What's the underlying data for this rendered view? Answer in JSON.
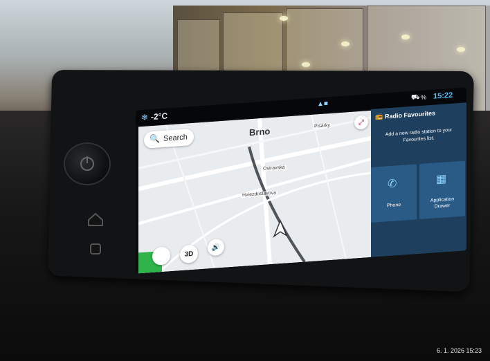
{
  "status": {
    "temperature": "-2°C",
    "time": "15:22",
    "battery": "%"
  },
  "map": {
    "city": "Brno",
    "search_label": "Search",
    "street_1": "Ostravská",
    "street_2": "Hviezdoslavova",
    "street_3": "Pisárky",
    "mode_button": "3D"
  },
  "panel": {
    "title": "Radio Favourites",
    "message": "Add a new radio station to your Favourites list.",
    "tiles": [
      {
        "label": "Phone",
        "icon": "phone-icon"
      },
      {
        "label": "Application Drawer",
        "icon": "app-drawer-icon"
      }
    ]
  },
  "photo": {
    "timestamp": "6. 1. 2026 15:23"
  },
  "colors": {
    "panel_bg": "#1e3f5e",
    "tile_bg": "#2a5a86",
    "status_time": "#4fc3f7",
    "map_bg": "#e9ecef"
  }
}
